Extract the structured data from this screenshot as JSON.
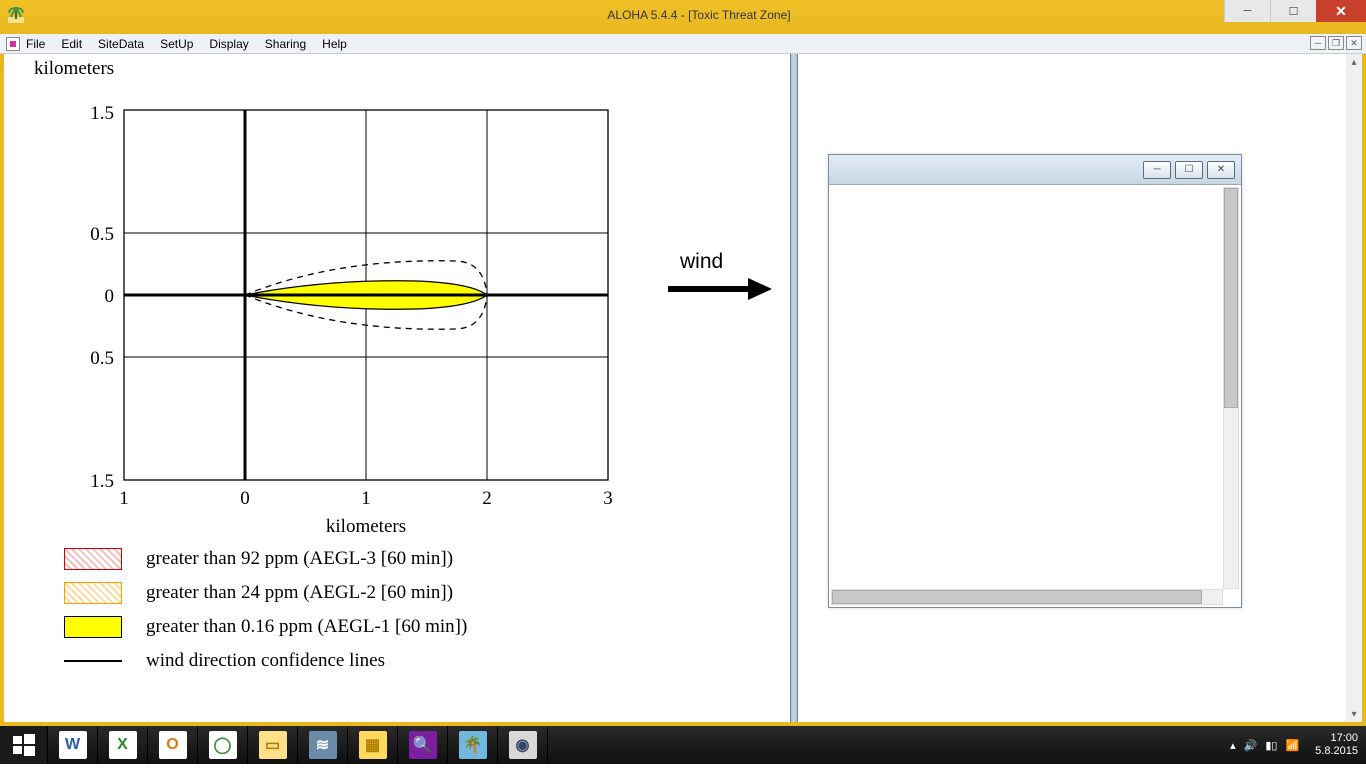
{
  "window": {
    "title": "ALOHA 5.4.4 - [Toxic Threat Zone]"
  },
  "menu": {
    "items": [
      "File",
      "Edit",
      "SiteData",
      "SetUp",
      "Display",
      "Sharing",
      "Help"
    ]
  },
  "chart_data": {
    "type": "plume_map",
    "xlabel": "kilometers",
    "ylabel": "kilometers",
    "x_ticks": [
      "1",
      "0",
      "1",
      "2",
      "3"
    ],
    "y_ticks": [
      "1.5",
      "0.5",
      "0",
      "0.5",
      "1.5"
    ],
    "xlim": [
      -1,
      3
    ],
    "ylim": [
      -1.5,
      1.5
    ],
    "wind_arrow_label": "wind",
    "wind_direction": "east",
    "plume": {
      "origin_km": [
        0,
        0
      ],
      "aegl1_extent_km": {
        "downwind": 2.0,
        "half_width_max": 0.12
      },
      "confidence_extent_km": {
        "downwind": 2.0,
        "half_width_max": 0.3
      }
    },
    "legend": [
      {
        "color": "red_hatch",
        "label": "greater than 92 ppm (AEGL-3 [60 min])"
      },
      {
        "color": "orange_hatch",
        "label": "greater than 24 ppm (AEGL-2 [60 min])"
      },
      {
        "color": "yellow",
        "label": "greater than 0.16 ppm (AEGL-1 [60 min])"
      },
      {
        "color": "line",
        "label": "wind direction confidence lines"
      }
    ]
  },
  "taskbar": {
    "apps": [
      {
        "label": "W",
        "bg": "#fff",
        "fg": "#2a5db0",
        "name": "word"
      },
      {
        "label": "X",
        "bg": "#fff",
        "fg": "#2c8a2c",
        "name": "excel"
      },
      {
        "label": "O",
        "bg": "#fff",
        "fg": "#d47f1a",
        "name": "outlook"
      },
      {
        "label": "◯",
        "bg": "#fff",
        "fg": "#3e8f3e",
        "name": "chrome"
      },
      {
        "label": "▭",
        "bg": "#ffe08a",
        "fg": "#b08000",
        "name": "explorer"
      },
      {
        "label": "≋",
        "bg": "#6a8ca8",
        "fg": "#fff",
        "name": "app6"
      },
      {
        "label": "▦",
        "bg": "#ffd860",
        "fg": "#b08000",
        "name": "app7"
      },
      {
        "label": "🔍",
        "bg": "#7a1fa0",
        "fg": "#fff",
        "name": "search"
      },
      {
        "label": "🌴",
        "bg": "#70b8e0",
        "fg": "#0a5020",
        "name": "aloha"
      },
      {
        "label": "◉",
        "bg": "#d8d8d8",
        "fg": "#334466",
        "name": "earth"
      }
    ],
    "clock_time": "17:00",
    "clock_date": "5.8.2015"
  }
}
